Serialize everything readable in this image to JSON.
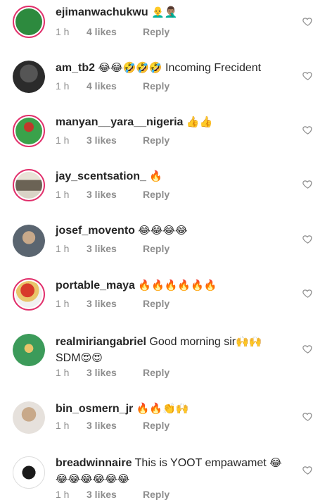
{
  "comments": [
    {
      "username": "ejimanwachukwu",
      "text": "",
      "emoji": "👨‍🦲🤦🏽‍♂️",
      "time": "1 h",
      "likes": "4 likes",
      "reply": "Reply",
      "avatar_color": "#2d8a3e"
    },
    {
      "username": "am_tb2",
      "text": "Incoming Frecident",
      "emoji_before": "😂😂🤣🤣🤣",
      "time": "1 h",
      "likes": "4 likes",
      "reply": "Reply",
      "avatar_color": "#2b2b2b"
    },
    {
      "username": "manyan__yara__nigeria",
      "text": "",
      "emoji": "👍👍",
      "time": "1 h",
      "likes": "3 likes",
      "reply": "Reply",
      "avatar_color": "#3aa24a"
    },
    {
      "username": "jay_scentsation_",
      "text": "",
      "emoji": "🔥",
      "time": "1 h",
      "likes": "3 likes",
      "reply": "Reply",
      "avatar_color": "#c9c2b4"
    },
    {
      "username": "josef_movento",
      "text": "",
      "emoji": "😂😂😂😂",
      "time": "1 h",
      "likes": "3 likes",
      "reply": "Reply",
      "avatar_color": "#5a6570"
    },
    {
      "username": "portable_maya",
      "text": "",
      "emoji": "🔥🔥🔥🔥🔥🔥",
      "time": "1 h",
      "likes": "3 likes",
      "reply": "Reply",
      "avatar_color": "#d8392b"
    },
    {
      "username": "realmiriangabriel",
      "text": "Good morning sir",
      "emoji": "🙌🙌",
      "line2": "SDM",
      "emoji2": "😍😍",
      "time": "1 h",
      "likes": "3 likes",
      "reply": "Reply",
      "avatar_color": "#3c9b5a"
    },
    {
      "username": "bin_osmern_jr",
      "text": "",
      "emoji": "🔥🔥👏🙌",
      "time": "1 h",
      "likes": "3 likes",
      "reply": "Reply",
      "avatar_color": "#8a7a70"
    },
    {
      "username": "breadwinnaire",
      "text": "This is YOOT empawamet",
      "emoji": "😂",
      "emoji2": "😂😂😂😂😂😂",
      "time": "1 h",
      "likes": "3 likes",
      "reply": "Reply",
      "avatar_color": "#1a1a1a"
    }
  ],
  "colors": {
    "heart_stroke": "#8e8e8e",
    "story_ring": "#e1306c",
    "meta_text": "#8e8e8e"
  },
  "icons": {
    "like": "heart-outline-icon"
  }
}
